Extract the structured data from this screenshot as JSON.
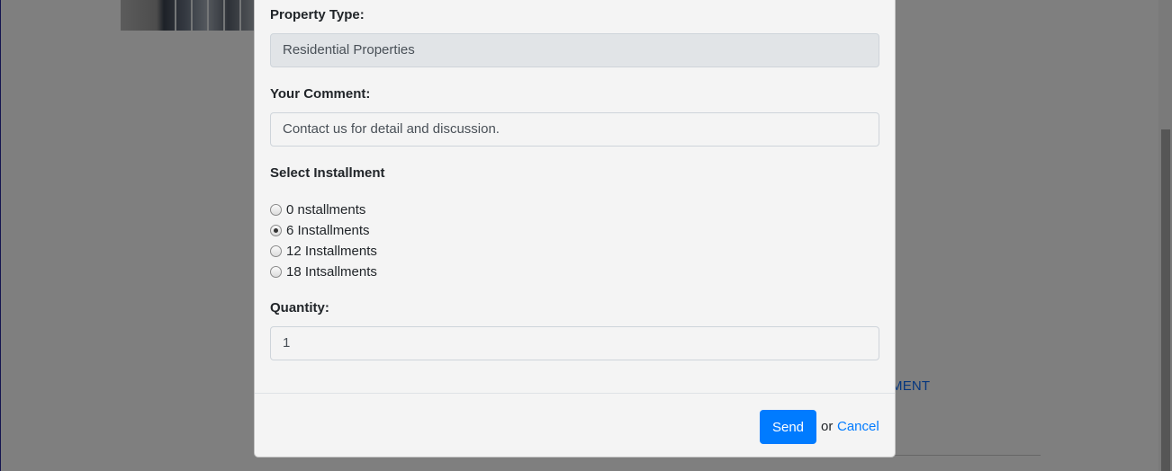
{
  "background": {
    "link_fragment": "MENT"
  },
  "form": {
    "property_type": {
      "label": "Property Type:",
      "value": "Residential Properties"
    },
    "comment": {
      "label": "Your Comment:",
      "value": "Contact us for detail and discussion."
    },
    "installment": {
      "label": "Select Installment",
      "options": [
        {
          "label": "0 nstallments",
          "checked": false
        },
        {
          "label": "6 Installments",
          "checked": true
        },
        {
          "label": "12 Installments",
          "checked": false
        },
        {
          "label": "18 Intsallments",
          "checked": false
        }
      ]
    },
    "quantity": {
      "label": "Quantity:",
      "value": "1"
    }
  },
  "footer": {
    "send_label": "Send",
    "or_text": "or",
    "cancel_label": "Cancel"
  },
  "colors": {
    "primary": "#007bff",
    "backdrop": "rgba(0,0,0,0.5)"
  }
}
